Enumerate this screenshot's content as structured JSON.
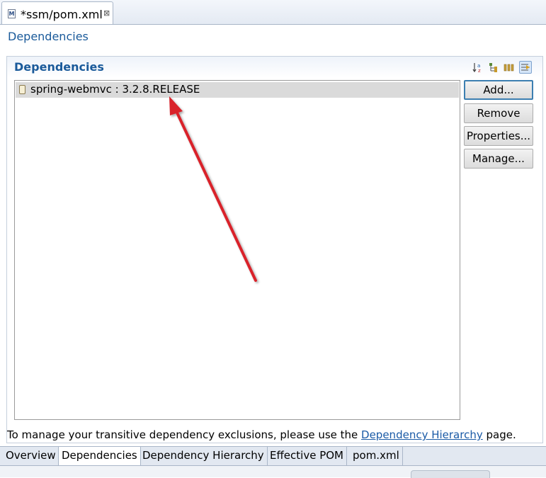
{
  "editor_tab": {
    "title": "*ssm/pom.xml",
    "icon": "maven-pom-icon",
    "close_glyph": "⊠"
  },
  "page": {
    "title": "Dependencies"
  },
  "section": {
    "title": "Dependencies",
    "toolbar_icons": [
      "sort-alphabetical-icon",
      "show-groupid-icon",
      "show-version-icon",
      "filter-icon"
    ]
  },
  "dependencies": [
    {
      "label": "spring-webmvc : 3.2.8.RELEASE",
      "icon": "jar-icon"
    }
  ],
  "buttons": {
    "add": "Add...",
    "remove": "Remove",
    "properties": "Properties...",
    "manage": "Manage..."
  },
  "info": {
    "prefix": "To manage your transitive dependency exclusions, please use the ",
    "link": "Dependency Hierarchy",
    "suffix": " page."
  },
  "bottom_tabs": [
    "Overview",
    "Dependencies",
    "Dependency Hierarchy",
    "Effective POM",
    "pom.xml"
  ],
  "active_bottom_tab": "Dependencies",
  "colors": {
    "accent_title": "#1a5a9a",
    "link": "#1a5aa6",
    "annotation_arrow": "#d9202a",
    "selected_row": "#dadada"
  }
}
